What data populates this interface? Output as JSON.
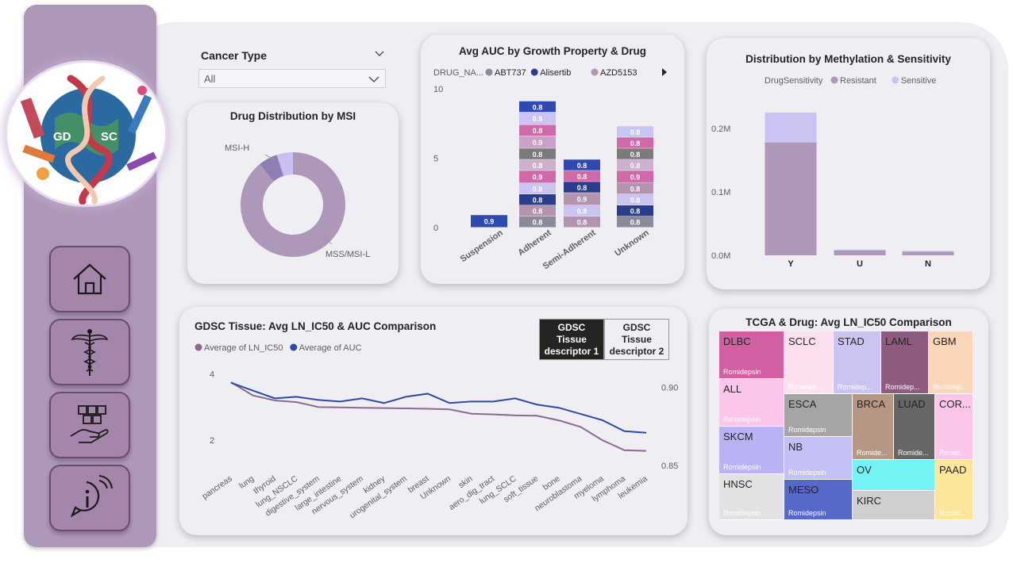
{
  "slicer": {
    "label": "Cancer Type",
    "value": "All"
  },
  "msi": {
    "title": "Drug Distribution by MSI",
    "labels": [
      "MSI-H",
      "MSS/MSI-L"
    ],
    "slices": [
      {
        "name": "MSS/MSI-L",
        "value": 0.89,
        "color": "#ae98b9"
      },
      {
        "name": "",
        "value": 0.06,
        "color": "#8e7eb6"
      },
      {
        "name": "MSI-H",
        "value": 0.05,
        "color": "#c9bff0"
      }
    ]
  },
  "auc": {
    "title": "Avg AUC by Growth Property & Drug",
    "legend_title": "DRUG_NA...",
    "legend": [
      {
        "name": "ABT737",
        "color": "#8a8a9a"
      },
      {
        "name": "Alisertib",
        "color": "#2a3c8a"
      },
      {
        "name": "AZD5153",
        "color": "#b493ae"
      }
    ],
    "yticks": [
      "10",
      "5",
      "0"
    ],
    "categories": [
      "Suspension",
      "Adherent",
      "Semi-Adherent",
      "Unknown"
    ]
  },
  "methylation": {
    "title": "Distribution by Methylation & Sensitivity",
    "legend_title": "DrugSensitivity",
    "legend": [
      {
        "name": "Resistant",
        "color": "#ae98b9"
      },
      {
        "name": "Sensitive",
        "color": "#cbc4f2"
      }
    ],
    "yticks": [
      "0.2M",
      "0.1M",
      "0.0M"
    ],
    "categories": [
      "Y",
      "U",
      "N"
    ]
  },
  "tissue": {
    "title": "GDSC Tissue: Avg LN_IC50 & AUC Comparison",
    "legend": [
      {
        "name": "Average of LN_IC50",
        "color": "#8a6a90"
      },
      {
        "name": "Average of AUC",
        "color": "#2e48a8"
      }
    ],
    "y_left": [
      "4",
      "2"
    ],
    "y_right": [
      "0.90",
      "0.85"
    ],
    "toggle1": "GDSC Tissue descriptor 1",
    "toggle2": "GDSC Tissue descriptor 2"
  },
  "tcga": {
    "title": "TCGA & Drug: Avg LN_IC50 Comparison",
    "cells": [
      {
        "label": "DLBC",
        "sub": "Romidepsin"
      },
      {
        "label": "SCLC",
        "sub": "Romidep..."
      },
      {
        "label": "STAD",
        "sub": "Romidep..."
      },
      {
        "label": "LAML",
        "sub": "Romidep..."
      },
      {
        "label": "GBM",
        "sub": "Romidep..."
      },
      {
        "label": "ALL",
        "sub": "Romidepsin"
      },
      {
        "label": "ESCA",
        "sub": "Romidepsin"
      },
      {
        "label": "BRCA",
        "sub": "Romide..."
      },
      {
        "label": "LUAD",
        "sub": "Romide..."
      },
      {
        "label": "COR...",
        "sub": "Romid..."
      },
      {
        "label": "SKCM",
        "sub": "Romidepsin"
      },
      {
        "label": "NB",
        "sub": "Romidepsin"
      },
      {
        "label": "OV",
        "sub": ""
      },
      {
        "label": "PAAD",
        "sub": "Romid..."
      },
      {
        "label": "HNSC",
        "sub": "Romidepsin"
      },
      {
        "label": "MESO",
        "sub": "Romidepsin"
      },
      {
        "label": "KIRC",
        "sub": ""
      }
    ]
  },
  "chart_data": [
    {
      "type": "bar",
      "title": "Avg AUC by Growth Property & Drug",
      "stacked": true,
      "categories": [
        "Suspension",
        "Adherent",
        "Semi-Adherent",
        "Unknown"
      ],
      "ylim": [
        0,
        10
      ],
      "segments": [
        [
          0.9
        ],
        [
          0.8,
          0.8,
          0.8,
          0.8,
          0.9,
          0.8,
          0.8,
          0.9,
          0.8,
          0.9,
          0.8
        ],
        [
          0.8,
          0.8,
          0.9,
          0.8,
          0.8,
          0.8
        ],
        [
          0.8,
          0.8,
          0.8,
          0.8,
          0.9,
          0.8,
          0.8,
          0.8,
          0.8
        ]
      ],
      "segment_colors": [
        [
          "#2e4ab0"
        ],
        [
          "#8a8a9a",
          "#b493ae",
          "#2a3c8a",
          "#cbc4f2",
          "#d069a8",
          "#ccb0cc",
          "#7b7b7b",
          "#c8a0c8",
          "#d069a8",
          "#cbc4f2",
          "#2e4ab0"
        ],
        [
          "#b493ae",
          "#cbc4f2",
          "#b493ae",
          "#2a3c8a",
          "#d069a8",
          "#2e4ab0"
        ],
        [
          "#8a8a9a",
          "#2a3c8a",
          "#cbc4f2",
          "#b493ae",
          "#d069a8",
          "#ccb0cc",
          "#7b7b7b",
          "#d069a8",
          "#cbc4f2"
        ]
      ]
    },
    {
      "type": "bar",
      "title": "Distribution by Methylation & Sensitivity",
      "stacked": true,
      "categories": [
        "Y",
        "U",
        "N"
      ],
      "ylim": [
        0,
        0.25
      ],
      "series": [
        {
          "name": "Resistant",
          "values": [
            0.178,
            0.008,
            0.006
          ]
        },
        {
          "name": "Sensitive",
          "values": [
            0.047,
            0.001,
            0.001
          ]
        }
      ]
    },
    {
      "type": "line",
      "title": "GDSC Tissue: Avg LN_IC50 & AUC Comparison",
      "categories": [
        "pancreas",
        "lung",
        "thyroid",
        "lung_NSCLC",
        "digestive_system",
        "large_intestine",
        "nervous_system",
        "kidney",
        "urogenital_system",
        "breast",
        "Unknown",
        "skin",
        "aero_dig_tract",
        "lung_SCLC",
        "soft_tissue",
        "bone",
        "neuroblastoma",
        "myeloma",
        "lymphoma",
        "leukemia"
      ],
      "ylim_left": [
        1.0,
        4.3
      ],
      "ylim_right": [
        0.845,
        0.915
      ],
      "series": [
        {
          "name": "Average of LN_IC50",
          "axis": "left",
          "values": [
            3.75,
            3.35,
            3.2,
            3.15,
            3.0,
            2.99,
            2.98,
            2.97,
            2.96,
            2.95,
            2.93,
            2.8,
            2.78,
            2.75,
            2.74,
            2.6,
            2.4,
            2.0,
            1.7,
            1.68
          ]
        },
        {
          "name": "Average of AUC",
          "axis": "right",
          "values": [
            0.903,
            0.898,
            0.893,
            0.894,
            0.892,
            0.891,
            0.893,
            0.89,
            0.894,
            0.896,
            0.89,
            0.891,
            0.891,
            0.893,
            0.889,
            0.887,
            0.883,
            0.879,
            0.872,
            0.871
          ]
        }
      ]
    },
    {
      "type": "treemap",
      "title": "TCGA & Drug: Avg LN_IC50 Comparison",
      "categories": [
        "DLBC",
        "SCLC",
        "STAD",
        "LAML",
        "GBM",
        "ALL",
        "ESCA",
        "BRCA",
        "LUAD",
        "COR...",
        "SKCM",
        "NB",
        "OV",
        "PAAD",
        "HNSC",
        "MESO",
        "KIRC"
      ]
    }
  ]
}
